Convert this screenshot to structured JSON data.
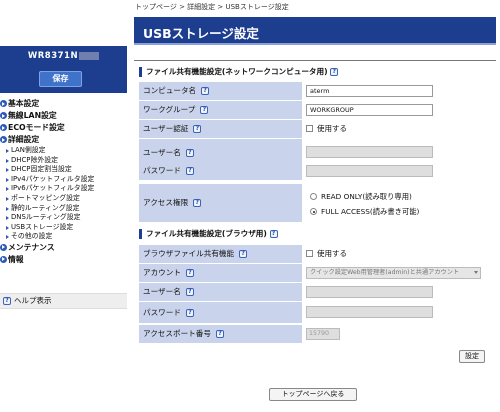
{
  "sidebar": {
    "model_name": "WR8371N",
    "save_label": "保存",
    "nav": [
      {
        "kind": "main",
        "label": "基本設定"
      },
      {
        "kind": "main",
        "label": "無線LAN設定"
      },
      {
        "kind": "main",
        "label": "ECOモード設定"
      },
      {
        "kind": "main",
        "label": "詳細設定"
      },
      {
        "kind": "sub",
        "label": "LAN側設定"
      },
      {
        "kind": "sub",
        "label": "DHCP除外設定"
      },
      {
        "kind": "sub",
        "label": "DHCP固定割当設定"
      },
      {
        "kind": "sub",
        "label": "IPv4パケットフィルタ設定"
      },
      {
        "kind": "sub",
        "label": "IPv6パケットフィルタ設定"
      },
      {
        "kind": "sub",
        "label": "ポートマッピング設定"
      },
      {
        "kind": "sub",
        "label": "静的ルーティング設定"
      },
      {
        "kind": "sub",
        "label": "DNSルーティング設定"
      },
      {
        "kind": "sub",
        "label": "USBストレージ設定"
      },
      {
        "kind": "sub",
        "label": "その他の設定"
      },
      {
        "kind": "main",
        "label": "メンテナンス"
      },
      {
        "kind": "main",
        "label": "情報"
      }
    ],
    "help_label": "ヘルプ表示"
  },
  "breadcrumb": "トップページ > 詳細設定 > USBストレージ設定",
  "page_title": "USBストレージ設定",
  "help_icon_text": "?",
  "network_section": {
    "title": "ファイル共有機能設定(ネットワークコンピュータ用)",
    "computer_name_label": "コンピュータ名",
    "computer_name_value": "aterm",
    "workgroup_label": "ワークグループ",
    "workgroup_value": "WORKGROUP",
    "user_auth_label": "ユーザー認証",
    "user_auth_checkbox_label": "使用する",
    "username_label": "ユーザー名",
    "password_label": "パスワード",
    "access_label": "アクセス権限",
    "access_options": [
      "READ ONLY(読み取り専用)",
      "FULL ACCESS(読み書き可能)"
    ]
  },
  "browser_section": {
    "title": "ファイル共有機能設定(ブラウザ用)",
    "browser_share_label": "ブラウザファイル共有機能",
    "browser_share_checkbox_label": "使用する",
    "account_label": "アカウント",
    "account_value": "クイック設定Web用管理者(admin)と共通アカウント",
    "username_label": "ユーザー名",
    "password_label": "パスワード",
    "port_label": "アクセスポート番号",
    "port_value": "15790"
  },
  "buttons": {
    "settings_label": "設定",
    "top_page_label": "トップページへ戻る"
  },
  "colors": {
    "header_blue": "#1d3d8f",
    "label_bg": "#c9d4ec"
  },
  "icons": {
    "help": "question-icon",
    "nav_main": "circle-arrow-icon",
    "nav_sub": "triangle-icon"
  }
}
